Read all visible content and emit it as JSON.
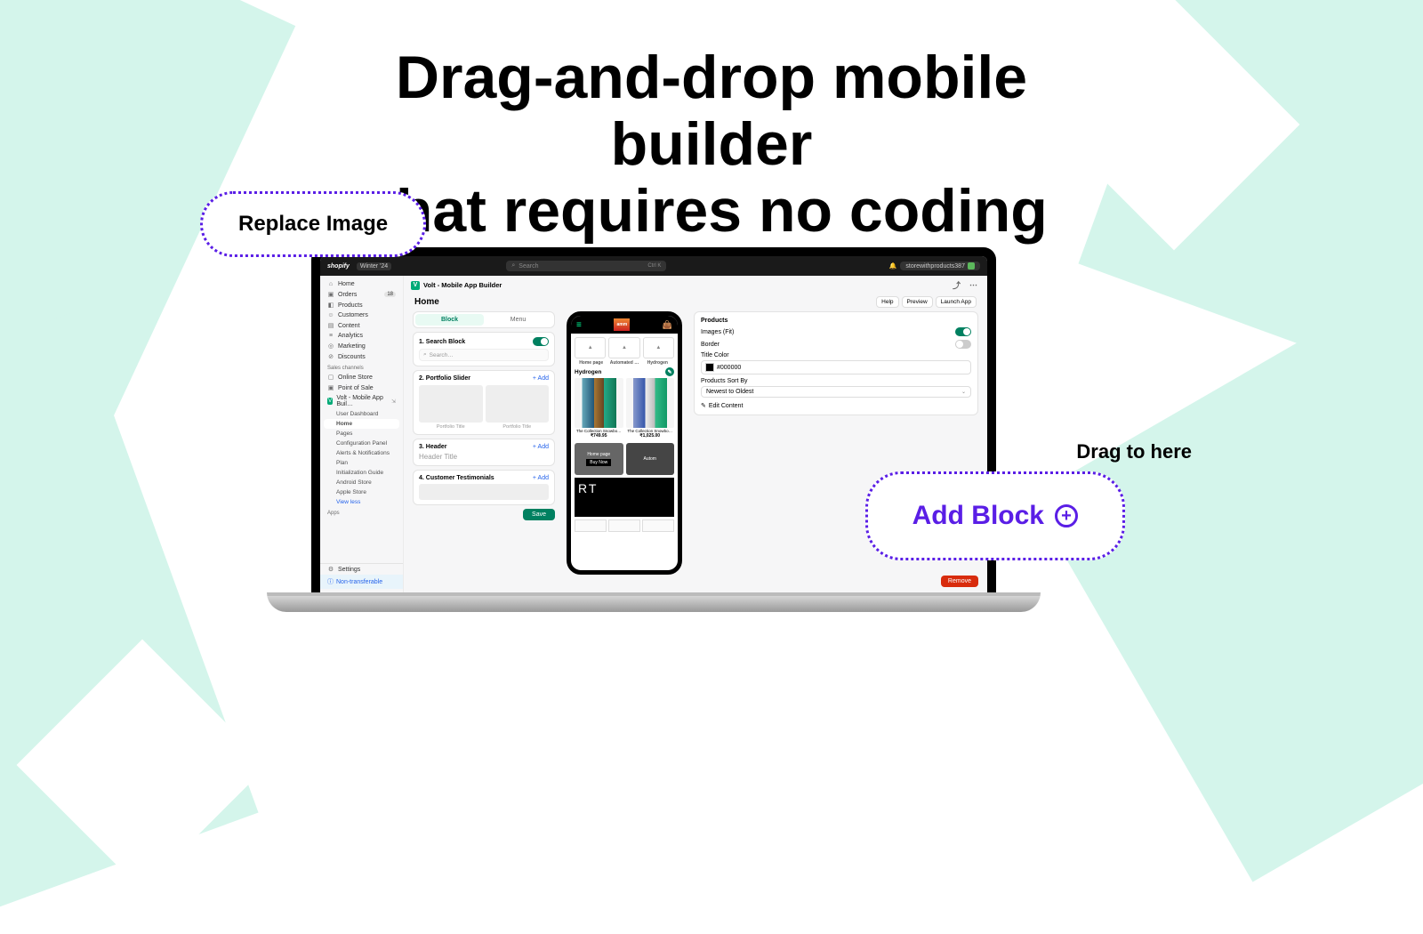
{
  "hero": {
    "line1": "Drag-and-drop mobile builder",
    "line2": "that requires no coding"
  },
  "callouts": {
    "replace": "Replace Image",
    "add": "Add Block",
    "drag_to_here": "Drag to here"
  },
  "topbar": {
    "brand": "shopify",
    "edition": "Winter '24",
    "search_placeholder": "Search",
    "search_kbd": "Ctrl K",
    "store_name": "storewithproducts387"
  },
  "sidebar": {
    "main": [
      {
        "icon": "⌂",
        "label": "Home"
      },
      {
        "icon": "▣",
        "label": "Orders",
        "badge": "18"
      },
      {
        "icon": "◧",
        "label": "Products"
      },
      {
        "icon": "☺",
        "label": "Customers"
      },
      {
        "icon": "▤",
        "label": "Content"
      },
      {
        "icon": "≡",
        "label": "Analytics"
      },
      {
        "icon": "◎",
        "label": "Marketing"
      },
      {
        "icon": "⊘",
        "label": "Discounts"
      }
    ],
    "sales_heading": "Sales channels",
    "sales": [
      {
        "icon": "▢",
        "label": "Online Store"
      },
      {
        "icon": "▣",
        "label": "Point of Sale"
      }
    ],
    "app_item": "Volt - Mobile App Buil…",
    "app_pin": "⇲",
    "app_sub": [
      "User Dashboard",
      "Home",
      "Pages",
      "Configuration Panel",
      "Alerts & Notifications",
      "Plan",
      "Initialization Guide",
      "Android Store",
      "Apple Store"
    ],
    "view_less": "View less",
    "apps_heading": "Apps",
    "settings": "Settings",
    "nontransferable": "Non-transferable"
  },
  "app_title": "Volt - Mobile App Builder",
  "page_title": "Home",
  "header_buttons": [
    "Help",
    "Preview",
    "Launch App"
  ],
  "tabs": {
    "block": "Block",
    "menu": "Menu"
  },
  "blocks": {
    "b1": {
      "title": "1. Search Block",
      "placeholder": "Search…"
    },
    "b2": {
      "title": "2. Portfolio Slider",
      "add": "+ Add",
      "item_title": "Portfolio Title"
    },
    "b3": {
      "title": "3. Header",
      "add": "+ Add",
      "placeholder": "Header Title"
    },
    "b4": {
      "title": "4. Customer Testimonials",
      "add": "+ Add"
    },
    "save": "Save"
  },
  "phone": {
    "logo": "amm",
    "tabs": [
      "Home page",
      "Automated …",
      "Hydrogen"
    ],
    "section": "Hydrogen",
    "product1": {
      "name": "The Collection Snowbo…",
      "price": "₹749.95"
    },
    "product2": {
      "name": "The Collection Snowbo…",
      "price": "₹1,025.00"
    },
    "banner1_label": "Home page",
    "banner1_btn": "Buy Now",
    "banner2_label": "Autom",
    "big_banner": "RT"
  },
  "props": {
    "heading": "Products",
    "images_fit": "Images (Fit)",
    "border": "Border",
    "title_color": "Title Color",
    "color_value": "#000000",
    "sort_by": "Products Sort By",
    "sort_value": "Newest to Oldest",
    "edit_content": "Edit Content",
    "remove": "Remove"
  }
}
